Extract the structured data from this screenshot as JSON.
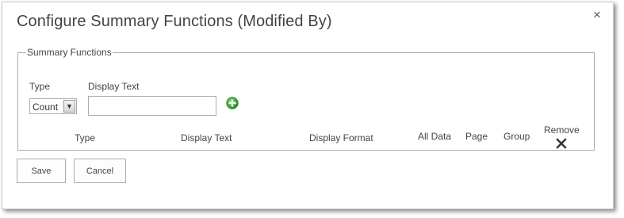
{
  "dialog": {
    "title": "Configure Summary Functions (Modified By)",
    "close_glyph": "×"
  },
  "summary": {
    "legend": "Summary Functions",
    "type_label": "Type",
    "display_text_label": "Display Text",
    "type_select": {
      "selected": "Count"
    },
    "display_text_value": "",
    "add_icon": "green-plus-icon",
    "table_headers": {
      "type": "Type",
      "display_text": "Display Text",
      "display_format": "Display Format",
      "all_data": "All Data",
      "page": "Page",
      "group": "Group",
      "remove": "Remove"
    },
    "remove_icon": "x-remove-icon"
  },
  "buttons": {
    "save": "Save",
    "cancel": "Cancel"
  },
  "colors": {
    "text": "#444444",
    "border": "#a8a8a8",
    "add_green": "#2e9e2e"
  }
}
